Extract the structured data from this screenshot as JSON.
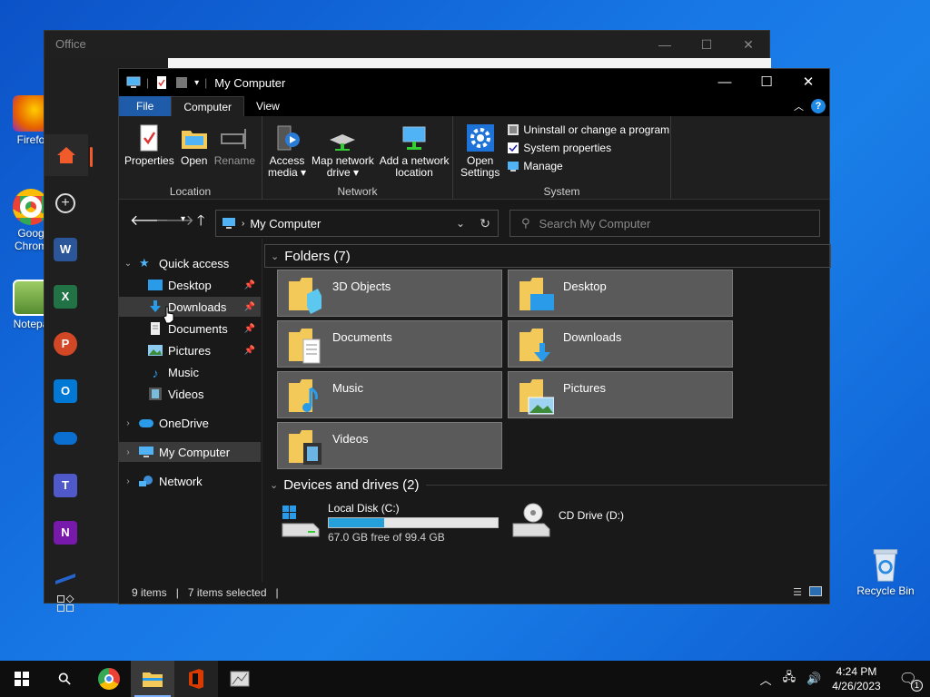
{
  "desktop": {
    "icons": [
      {
        "label": "Firefo",
        "color": "#e66000"
      },
      {
        "label": "Goog Chrom",
        "color": "#4285f4"
      },
      {
        "label": "Notepa",
        "color": "#8bc34a"
      }
    ],
    "recycle_bin": "Recycle Bin"
  },
  "office": {
    "title": "Office",
    "caption": {
      "min": "—",
      "max": "☐",
      "close": "✕"
    }
  },
  "explorer": {
    "title": "My Computer",
    "caption": {
      "min": "—",
      "max": "☐",
      "close": "✕"
    },
    "tabs": {
      "file": "File",
      "computer": "Computer",
      "view": "View"
    },
    "help": "?",
    "ribbon": {
      "location": {
        "label": "Location",
        "properties": "Properties",
        "open": "Open",
        "rename": "Rename"
      },
      "network": {
        "label": "Network",
        "access_media_1": "Access",
        "access_media_2": "media ▾",
        "map_drive_1": "Map network",
        "map_drive_2": "drive ▾",
        "add_location_1": "Add a network",
        "add_location_2": "location"
      },
      "system": {
        "label": "System",
        "open_settings_1": "Open",
        "open_settings_2": "Settings",
        "uninstall": "Uninstall or change a program",
        "system_properties": "System properties",
        "manage": "Manage"
      }
    },
    "address": {
      "path": "My Computer",
      "search_placeholder": "Search My Computer"
    },
    "nav": {
      "quick_access": "Quick access",
      "desktop": "Desktop",
      "downloads": "Downloads",
      "documents": "Documents",
      "pictures": "Pictures",
      "music": "Music",
      "videos": "Videos",
      "onedrive": "OneDrive",
      "my_computer": "My Computer",
      "network": "Network"
    },
    "content": {
      "folders_header": "Folders (7)",
      "folders": {
        "f3d": "3D Objects",
        "desktop": "Desktop",
        "documents": "Documents",
        "downloads": "Downloads",
        "music": "Music",
        "pictures": "Pictures",
        "videos": "Videos"
      },
      "devices_header": "Devices and drives (2)",
      "local_disk": {
        "name": "Local Disk (C:)",
        "free_text": "67.0 GB free of 99.4 GB",
        "used_fraction": 0.326
      },
      "cd_drive": "CD Drive (D:)"
    },
    "status": {
      "items": "9 items",
      "selected": "7 items selected"
    }
  },
  "taskbar": {
    "time": "4:24 PM",
    "date": "4/26/2023",
    "notifications": "1"
  },
  "colors": {
    "accent": "#1e5ba8",
    "folder": "#f3c95a",
    "drive_fill": "#26a0da"
  }
}
